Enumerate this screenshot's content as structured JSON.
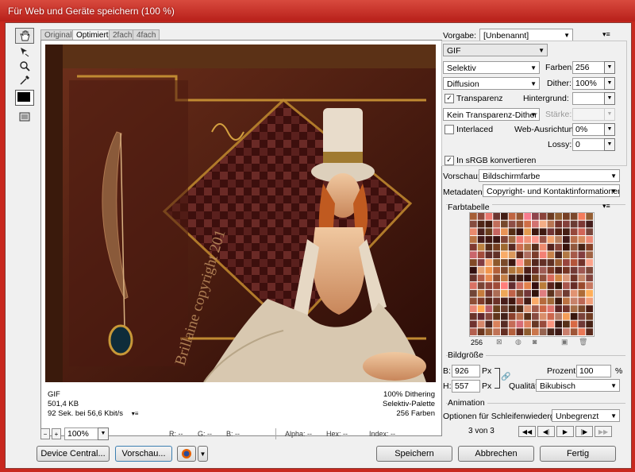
{
  "window": {
    "title": "Für Web und Geräte speichern (100 %)"
  },
  "tabs": [
    {
      "label": "Original"
    },
    {
      "label": "Optimiert"
    },
    {
      "label": "2fach"
    },
    {
      "label": "4fach"
    }
  ],
  "preview_info": {
    "format": "GIF",
    "size": "501,4 KB",
    "time": "92 Sek. bei 56,6 Kbit/s",
    "dither": "100% Dithering",
    "palette": "Selektiv-Palette",
    "colors_count": "256 Farben"
  },
  "artwork_text": {
    "watermark": "Brillaine copyright 201"
  },
  "zoom": {
    "value": "100%"
  },
  "statusbar": {
    "r": "R: --",
    "g": "G: --",
    "b": "B: --",
    "alpha": "Alpha: --",
    "hex": "Hex: --",
    "index": "Index: --"
  },
  "settings": {
    "vorgabe_label": "Vorgabe:",
    "vorgabe_value": "[Unbenannt]",
    "format": "GIF",
    "reduction": "Selektiv",
    "farben_label": "Farben:",
    "farben_value": "256",
    "dither_algo": "Diffusion",
    "dither_label": "Dither:",
    "dither_value": "100%",
    "transparenz_label": "Transparenz",
    "hintergrund_label": "Hintergrund:",
    "trans_dither": "Kein Transparenz-Dither",
    "staerke_label": "Stärke:",
    "interlaced_label": "Interlaced",
    "web_label": "Web-Ausrichtung:",
    "web_value": "0%",
    "lossy_label": "Lossy:",
    "lossy_value": "0",
    "srgb_label": "In sRGB konvertieren",
    "vorschau_label": "Vorschau:",
    "vorschau_value": "Bildschirmfarbe",
    "metadaten_label": "Metadaten:",
    "metadaten_value": "Copyright- und Kontaktinformationen"
  },
  "farbtabelle": {
    "title": "Farbtabelle",
    "count": "256"
  },
  "bildgroesse": {
    "title": "Bildgröße",
    "b_label": "B:",
    "b_value": "926",
    "b_unit": "Px",
    "h_label": "H:",
    "h_value": "557",
    "h_unit": "Px",
    "prozent_label": "Prozent:",
    "prozent_value": "100",
    "prozent_unit": "%",
    "qualitaet_label": "Qualität:",
    "qualitaet_value": "Bikubisch"
  },
  "animation": {
    "title": "Animation",
    "loop_label": "Optionen für Schleifenwiedergabe:",
    "loop_value": "Unbegrenzt",
    "frame_counter": "3 von 3"
  },
  "buttons": {
    "device_central": "Device Central...",
    "vorschau": "Vorschau...",
    "speichern": "Speichern",
    "abbrechen": "Abbrechen",
    "fertig": "Fertig"
  },
  "colors": {
    "titlebar": "#c8281e",
    "panel": "#f0f0f0",
    "art_bg": "#3a140c"
  }
}
